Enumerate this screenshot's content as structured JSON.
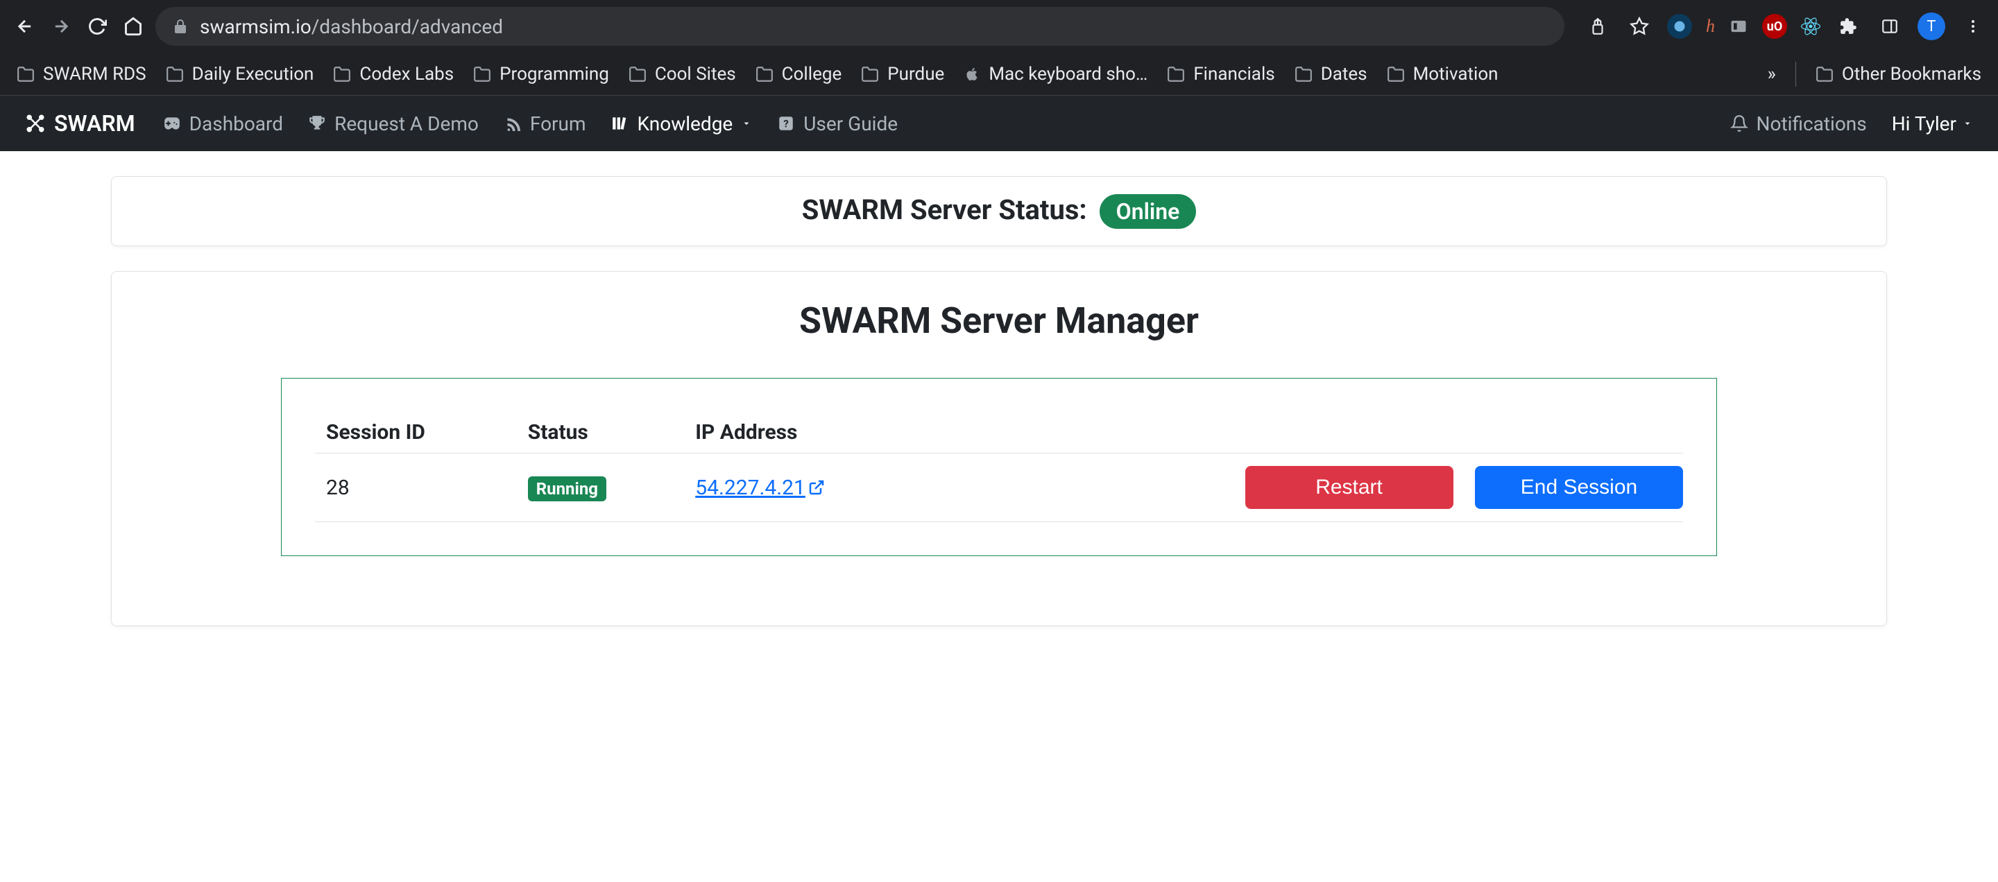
{
  "browser": {
    "url_domain": "swarmsim.io",
    "url_path": "/dashboard/advanced",
    "avatar_letter": "T"
  },
  "bookmarks": {
    "items": [
      {
        "label": "SWARM RDS",
        "icon": "folder"
      },
      {
        "label": "Daily Execution",
        "icon": "folder"
      },
      {
        "label": "Codex Labs",
        "icon": "folder"
      },
      {
        "label": "Programming",
        "icon": "folder"
      },
      {
        "label": "Cool Sites",
        "icon": "folder"
      },
      {
        "label": "College",
        "icon": "folder"
      },
      {
        "label": "Purdue",
        "icon": "folder"
      },
      {
        "label": "Mac keyboard sho…",
        "icon": "apple"
      },
      {
        "label": "Financials",
        "icon": "folder"
      },
      {
        "label": "Dates",
        "icon": "folder"
      },
      {
        "label": "Motivation",
        "icon": "folder"
      }
    ],
    "overflow": "»",
    "other": "Other Bookmarks"
  },
  "appnav": {
    "brand": "SWARM",
    "links": [
      {
        "label": "Dashboard",
        "icon": "gamepad",
        "active": false
      },
      {
        "label": "Request A Demo",
        "icon": "trophy",
        "active": false
      },
      {
        "label": "Forum",
        "icon": "rss",
        "active": false
      },
      {
        "label": "Knowledge",
        "icon": "books",
        "active": true,
        "dropdown": true
      },
      {
        "label": "User Guide",
        "icon": "question",
        "active": false
      }
    ],
    "notifications": "Notifications",
    "greeting": "Hi Tyler"
  },
  "status_card": {
    "label": "SWARM Server Status:",
    "badge": "Online"
  },
  "manager": {
    "title": "SWARM Server Manager",
    "columns": [
      "Session ID",
      "Status",
      "IP Address",
      ""
    ],
    "row": {
      "session_id": "28",
      "status_badge": "Running",
      "ip": "54.227.4.21",
      "restart": "Restart",
      "end": "End Session"
    }
  }
}
